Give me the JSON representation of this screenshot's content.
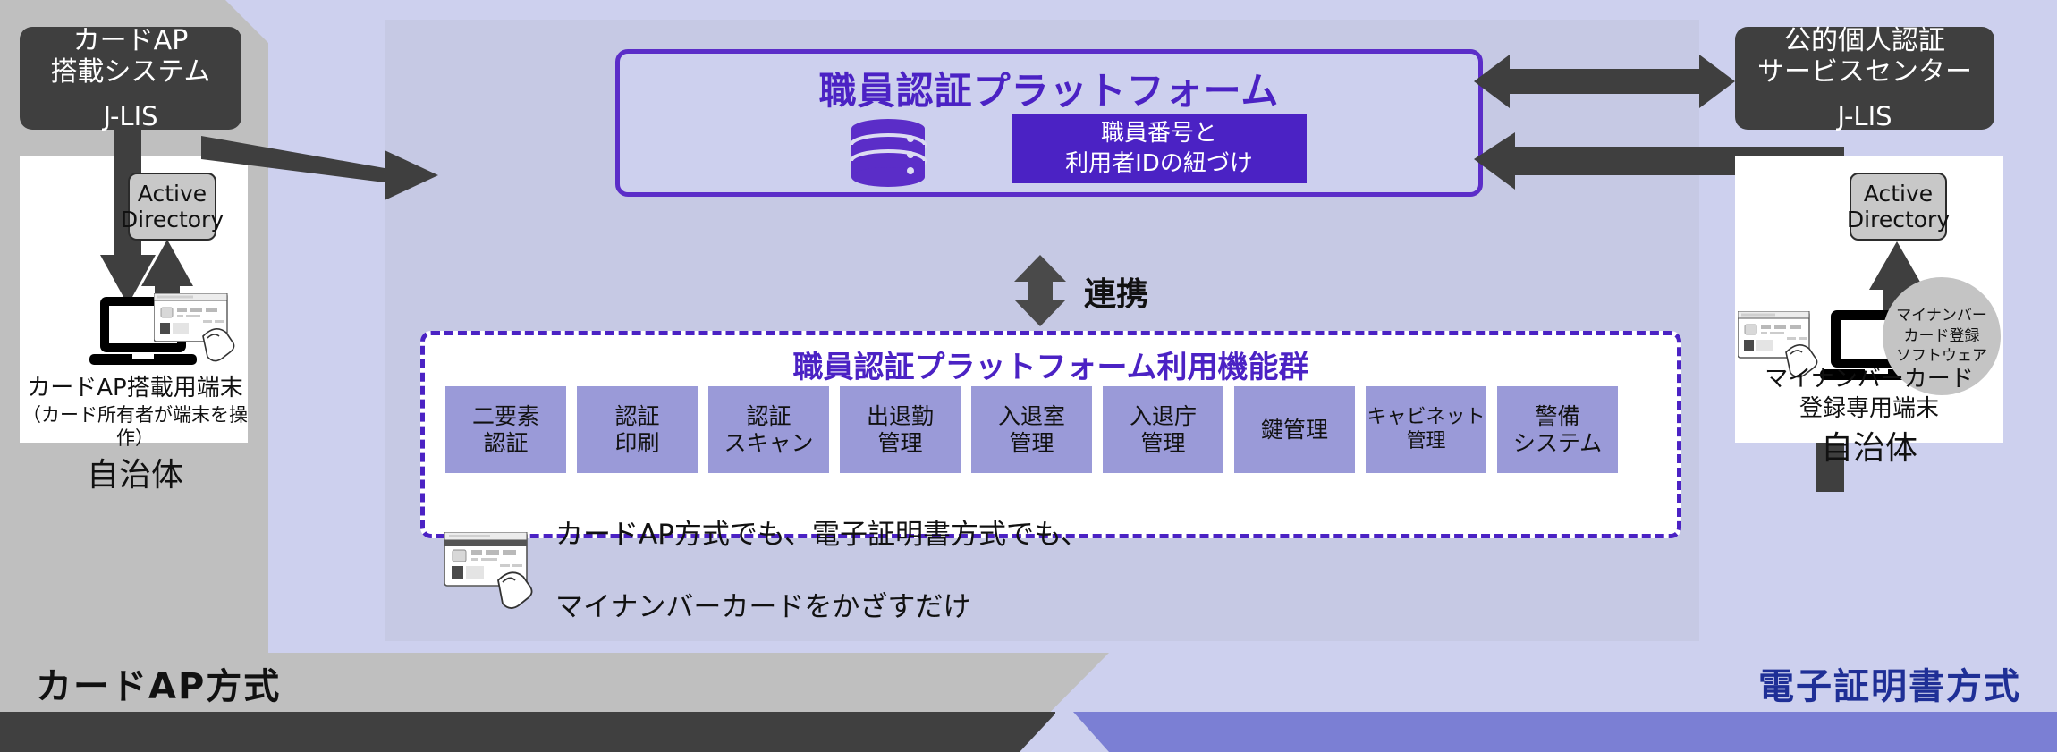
{
  "left_system": {
    "line1": "カードAP",
    "line2": "搭載システム",
    "org": "J-LIS"
  },
  "right_system": {
    "line1": "公的個人認証",
    "line2": "サービスセンター",
    "org": "J-LIS"
  },
  "active_directory": {
    "line1": "Active",
    "line2": "Directory"
  },
  "platform": {
    "title": "職員認証プラットフォーム",
    "db_icon": "database-icon",
    "link_box_line1": "職員番号と",
    "link_box_line2": "利用者IDの紐づけ"
  },
  "renkei": {
    "label": "連携",
    "arrow_icon": "double-arrow-vertical-icon"
  },
  "functions": {
    "title": "職員認証プラットフォーム利用機能群",
    "items": [
      {
        "line1": "二要素",
        "line2": "認証"
      },
      {
        "line1": "認証",
        "line2": "印刷"
      },
      {
        "line1": "認証",
        "line2": "スキャン"
      },
      {
        "line1": "出退勤",
        "line2": "管理"
      },
      {
        "line1": "入退室",
        "line2": "管理"
      },
      {
        "line1": "入退庁",
        "line2": "管理"
      },
      {
        "line1": "鍵管理",
        "line2": ""
      },
      {
        "line1": "キャビネット",
        "line2": "管理"
      },
      {
        "line1": "警備",
        "line2": "システム"
      }
    ],
    "note_line1": "カードAP方式でも、電子証明書方式でも、",
    "note_line2": "マイナンバーカードをかざすだけ",
    "note_icon": "card-tap-icon"
  },
  "left_terminal": {
    "caption_line1": "カードAP搭載用端末",
    "caption_line2": "（カード所有者が端末を操作）",
    "caption_line3": "自治体",
    "laptop_icon": "laptop-icon",
    "card_icon": "card-tap-icon"
  },
  "right_terminal": {
    "caption_line1": "マイナンバーカード",
    "caption_line2": "登録専用端末",
    "caption_line3": "自治体",
    "software_note_line1": "マイナンバー",
    "software_note_line2": "カード登録",
    "software_note_line3": "ソフトウェア",
    "laptop_icon": "laptop-icon",
    "card_icon": "card-tap-icon"
  },
  "banners": {
    "left": "カードAP方式",
    "right": "電子証明書方式"
  },
  "colors": {
    "accent_purple": "#4b22c4",
    "light_lavender": "#cdd0ee",
    "function_box": "#9a9ad8",
    "dark_box": "#3f3f3f",
    "gray_panel": "#bfbfbf",
    "banner_right_bar": "#7b7fd4",
    "banner_right_text": "#1f2f96"
  }
}
